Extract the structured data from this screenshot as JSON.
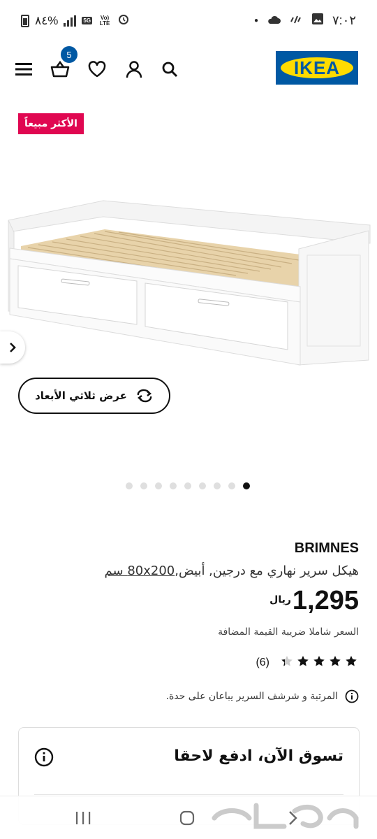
{
  "status_bar": {
    "battery": "٨٤%",
    "network": "5G",
    "volte": "Vo) LTE",
    "time": "٧:٠٢"
  },
  "header": {
    "logo_text": "IKEA",
    "cart_count": "5",
    "icons": [
      "menu-icon",
      "cart-icon",
      "heart-icon",
      "user-icon",
      "search-icon"
    ],
    "brand_blue": "#0058a3",
    "brand_yellow": "#ffdb00"
  },
  "badge": {
    "label": "الأكثر مبيعاً",
    "color": "#e00751"
  },
  "media": {
    "view3d_label": "عرض ثلاثي الأبعاد",
    "dots_total": 9,
    "dots_active_index": 8
  },
  "product": {
    "name": "BRIMNES",
    "description_main": "هيكل سرير نهاري مع درجين, أبيض,",
    "description_size": "80x200 سم",
    "price_amount": "1,295",
    "price_currency": "ريال",
    "vat_note": "السعر شاملا ضريبة القيمة المضافة",
    "rating_value": 4.5,
    "rating_count": "(6)",
    "info_note": "المرتبة و شرشف السرير يباعان على حدة."
  },
  "bnpl": {
    "title": "تسوق الآن، ادفع لاحقا"
  },
  "watermark": "حراج"
}
